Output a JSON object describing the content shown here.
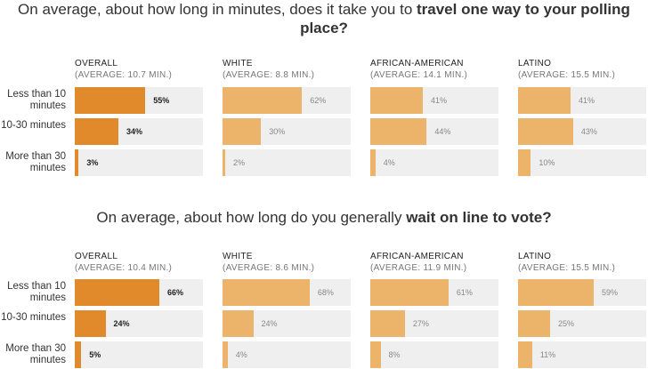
{
  "chart_data": [
    {
      "type": "bar",
      "title": {
        "prefix": "On average, about how long in minutes, does it take you to ",
        "bold": "travel one way to your polling place?"
      },
      "categories": [
        "Less than 10 minutes",
        "10-30 minutes",
        "More than 30 minutes"
      ],
      "series": [
        {
          "name": "OVERALL",
          "average": "(AVERAGE: 10.7 MIN.)",
          "values": [
            55,
            34,
            3
          ],
          "labels": [
            "55%",
            "34%",
            "3%"
          ]
        },
        {
          "name": "WHITE",
          "average": "(AVERAGE: 8.8 MIN.)",
          "values": [
            62,
            30,
            2
          ],
          "labels": [
            "62%",
            "30%",
            "2%"
          ]
        },
        {
          "name": "AFRICAN-AMERICAN",
          "average": "(AVERAGE: 14.1 MIN.)",
          "values": [
            41,
            44,
            4
          ],
          "labels": [
            "41%",
            "44%",
            "4%"
          ]
        },
        {
          "name": "LATINO",
          "average": "(AVERAGE: 15.5 MIN.)",
          "values": [
            41,
            43,
            10
          ],
          "labels": [
            "41%",
            "43%",
            "10%"
          ]
        }
      ]
    },
    {
      "type": "bar",
      "title": {
        "prefix": "On average, about how long do you generally ",
        "bold": "wait on line to vote?"
      },
      "categories": [
        "Less than 10 minutes",
        "10-30 minutes",
        "More than 30 minutes"
      ],
      "series": [
        {
          "name": "OVERALL",
          "average": "(AVERAGE: 10.4 MIN.)",
          "values": [
            66,
            24,
            5
          ],
          "labels": [
            "66%",
            "24%",
            "5%"
          ]
        },
        {
          "name": "WHITE",
          "average": "(AVERAGE: 8.6 MIN.)",
          "values": [
            68,
            24,
            4
          ],
          "labels": [
            "68%",
            "24%",
            "4%"
          ]
        },
        {
          "name": "AFRICAN-AMERICAN",
          "average": "(AVERAGE: 11.9 MIN.)",
          "values": [
            61,
            27,
            8
          ],
          "labels": [
            "61%",
            "27%",
            "8%"
          ]
        },
        {
          "name": "LATINO",
          "average": "(AVERAGE: 15.5 MIN.)",
          "values": [
            59,
            25,
            11
          ],
          "labels": [
            "59%",
            "25%",
            "11%"
          ]
        }
      ]
    }
  ],
  "colors": {
    "overall_bar": "#e08a2c",
    "group_bar": "#ebb46a",
    "track": "#efefef",
    "overall_label": "#222222",
    "group_label": "#888888"
  }
}
